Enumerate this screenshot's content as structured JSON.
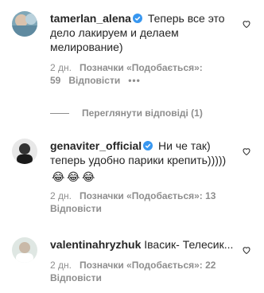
{
  "comments": [
    {
      "username": "tamerlan_alena",
      "verified": true,
      "text": "Теперь все это дело лакируем и делаем мелирование)",
      "age": "2 дн.",
      "likes": "Позначки «Подобається»: 59",
      "reply": "Відповісти",
      "more": "•••"
    },
    {
      "username": "genaviter_official",
      "verified": true,
      "text": "Ни че так) теперь удобно парики крепить)))))",
      "emojis": [
        "😂",
        "😂",
        "😂"
      ],
      "age": "2 дн.",
      "likes": "Позначки «Подобається»: 13",
      "reply": "Відповісти"
    },
    {
      "username": "valentinahryzhuk",
      "verified": false,
      "text": "Івасик- Телесик...",
      "age": "2 дн.",
      "likes": "Позначки «Подобається»: 22",
      "reply": "Відповісти"
    }
  ],
  "view_replies": "Переглянути відповіді (1)",
  "colors": {
    "text": "#262626",
    "secondary": "#8e8e8e",
    "verified": "#3897f0"
  },
  "icons": {
    "verified": "verified-badge-icon",
    "like": "heart-outline-icon"
  }
}
